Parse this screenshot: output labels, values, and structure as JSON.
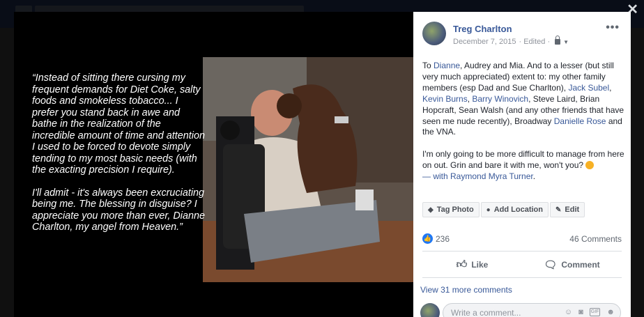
{
  "quote": {
    "paragraph1": "“Instead of sitting there cursing my frequent demands for Diet Coke, salty foods and smokeless tobacco... I prefer you stand back in awe and bathe in the realization of the incredible amount of time and attention I used to be forced to devote simply tending to my most basic needs (with the exacting precision I require).",
    "paragraph2": "I'll admit - it's always been excruciating being me. The blessing in disguise? I appreciate you more than ever, Dianne Charlton, my angel from Heaven.”"
  },
  "post": {
    "author": "Treg Charlton",
    "date": "December 7, 2015",
    "edited": "· Edited ·",
    "more_label": "•••",
    "body": {
      "p1_t1": "To ",
      "p1_l1": "Dianne",
      "p1_t2": ", Audrey and Mia. And to a lesser (but still very much appreciated) extent to: my other family members (esp Dad and Sue Charlton), ",
      "p1_l2": "Jack Subel",
      "p1_t3": ", ",
      "p1_l3": "Kevin Burns",
      "p1_t4": ", ",
      "p1_l4": "Barry Winovich",
      "p1_t5": ", Steve Laird, Brian Hopcraft, Sean Walsh (and any other friends that have seen me nude recently), Broadway ",
      "p1_l5": "Danielle Rose",
      "p1_t6": " and the VNA.",
      "p2_text": "I'm only going to be more difficult to manage from here on out. Grin and bare it with me, won't you? ",
      "p2_with": "— with ",
      "p2_tag": "Raymond Myra Turner",
      "p2_end": "."
    },
    "actions": {
      "tag_photo": "Tag Photo",
      "add_location": "Add Location",
      "edit": "Edit"
    },
    "stats": {
      "likes": "236",
      "comments": "46 Comments"
    },
    "react": {
      "like": "Like",
      "comment": "Comment"
    },
    "view_more": "View 31 more comments",
    "comment_placeholder": "Write a comment...",
    "gif_label": "GIF"
  },
  "icons": {
    "close": "close-icon",
    "lock": "lock-icon",
    "tag": "tag-icon",
    "location": "location-pin-icon",
    "edit": "pencil-icon",
    "like": "thumbs-up-icon",
    "comment": "speech-bubble-icon",
    "emoji": "smiley-icon",
    "camera": "camera-icon",
    "sticker": "sticker-icon"
  },
  "colors": {
    "link": "#385898",
    "like_badge": "#2078f4"
  }
}
